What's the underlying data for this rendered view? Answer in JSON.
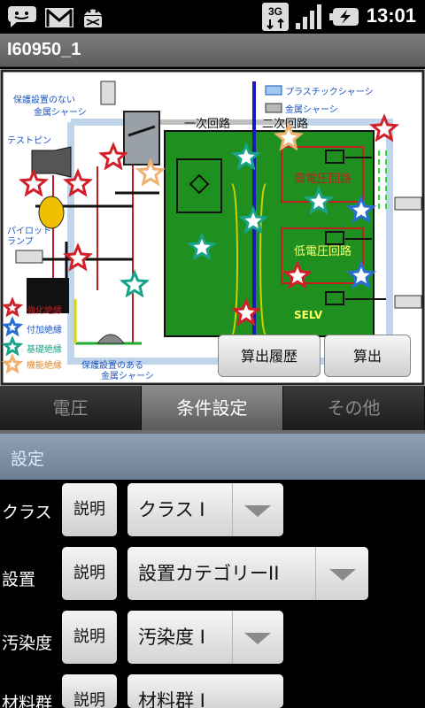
{
  "status_bar": {
    "time": "13:01",
    "network": "3G",
    "icons": [
      "messenger-icon",
      "gmail-icon",
      "android-debug-icon",
      "3g-data-icon",
      "signal-icon",
      "battery-charging-icon"
    ]
  },
  "app": {
    "title": "I60950_1"
  },
  "diagram": {
    "labels": {
      "unprotected_chassis_1": "保護設置のない",
      "unprotected_chassis_2": "金属シャーシ",
      "test_pin": "テストピン",
      "pilot_lamp_1": "パイロット",
      "pilot_lamp_2": "ランプ",
      "plastic_chassis": "プラスチックシャーシ",
      "metal_chassis": "金属シャーシ",
      "primary_circuit": "一次回路",
      "secondary_circuit": "二次回路",
      "high_voltage": "高電圧回路",
      "low_voltage": "低電圧回路",
      "selv": "SELV",
      "protected_chassis_1": "保護設置のある",
      "protected_chassis_2": "金属シャーシ"
    },
    "legend": [
      "強化絶縁",
      "付加絶縁",
      "基礎絶縁",
      "機能絶縁"
    ],
    "buttons": {
      "history": "算出履歴",
      "calculate": "算出"
    }
  },
  "tabs": [
    {
      "label": "電圧",
      "active": false
    },
    {
      "label": "条件設定",
      "active": true
    },
    {
      "label": "その他",
      "active": false
    }
  ],
  "settings": {
    "header": "設定",
    "rows": [
      {
        "label": "クラス",
        "button": "説明",
        "value": "クラス I"
      },
      {
        "label": "設置",
        "button": "説明",
        "value": "設置カテゴリーII"
      },
      {
        "label": "汚染度",
        "button": "説明",
        "value": "汚染度 I"
      },
      {
        "label": "材料群",
        "button": "説明",
        "value": "材料群 I"
      }
    ]
  },
  "colors": {
    "board_green": "#1f8f1f",
    "title_bar": "#6d6d6d",
    "settings_header": "#7f90a4",
    "star_red": "#d0202a",
    "star_blue": "#2a6fd0",
    "star_teal": "#1aa389",
    "star_peach": "#f0b070"
  }
}
